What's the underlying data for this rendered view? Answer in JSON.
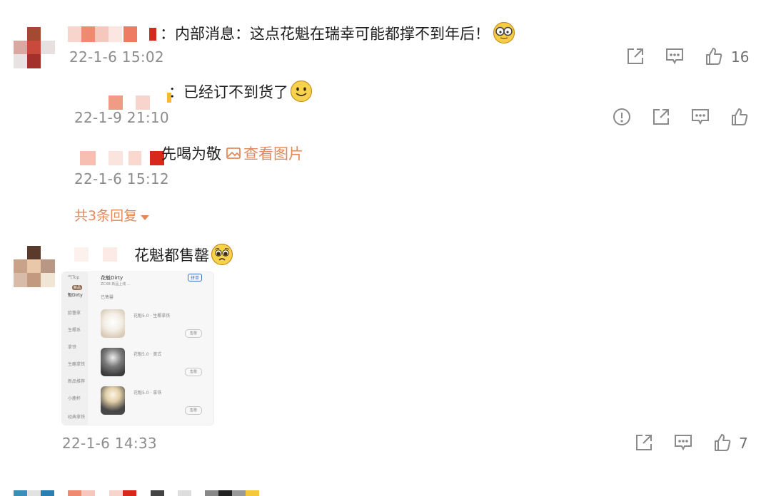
{
  "comments": [
    {
      "text": "：内部消息：这点花魁在瑞幸可能都撑不到年后！",
      "emoji": "glasses-emoji",
      "timestamp": "22-1-6 15:02",
      "like_count": "16"
    },
    {
      "replies": [
        {
          "text": "：已经订不到货了",
          "emoji": "smile-emoji",
          "timestamp": "22-1-9 21:10"
        },
        {
          "text": "先喝为敬",
          "view_image_label": "查看图片",
          "timestamp": "22-1-6 15:12"
        }
      ],
      "more_replies_label": "共3条回复"
    },
    {
      "text": "花魁都售罄",
      "emoji": "pleading-emoji",
      "timestamp": "22-1-6 14:33",
      "like_count": "7"
    }
  ],
  "thumbnail": {
    "tab_label": "气Top",
    "side_items": [
      "新品",
      "魁Dirty",
      "欧蕾拿",
      "生椰系",
      "拿铁",
      "生酪拿铁",
      "新品推荐",
      "小鹿杯",
      "经典拿铁"
    ],
    "header_title": "花魁Dirty",
    "header_sub": "ZCXB 新品上线 ...",
    "sort_label": "拼单",
    "section_label": "已售罄",
    "products": [
      {
        "name": "花魁5.0 · 生椰拿铁",
        "button": "售罄"
      },
      {
        "name": "花魁5.0 · 美式",
        "button": "售罄"
      },
      {
        "name": "花魁5.0 · 拿铁",
        "button": "售罄"
      }
    ]
  },
  "colors": {
    "accent": "#e08a5c",
    "timestamp": "#8c8c8c",
    "icon": "#8a8a8a"
  }
}
